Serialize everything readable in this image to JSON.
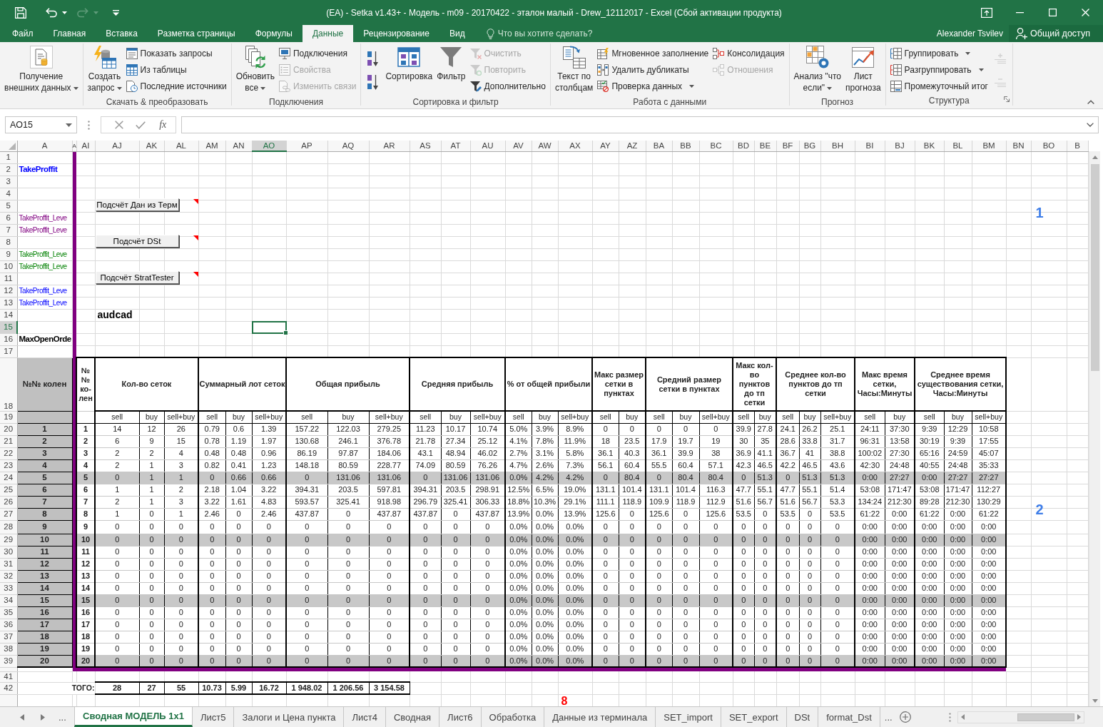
{
  "window": {
    "title": "(EA) - Setka v1.43+ - Модель - m09 - 20170422 - эталон малый - Drew_12112017 - Excel (Сбой активации продукта)"
  },
  "ribbon_tabs": [
    {
      "label": "Файл",
      "selected": false
    },
    {
      "label": "Главная",
      "selected": false
    },
    {
      "label": "Вставка",
      "selected": false
    },
    {
      "label": "Разметка страницы",
      "selected": false
    },
    {
      "label": "Формулы",
      "selected": false
    },
    {
      "label": "Данные",
      "selected": true
    },
    {
      "label": "Рецензирование",
      "selected": false
    },
    {
      "label": "Вид",
      "selected": false
    }
  ],
  "tell_me": {
    "placeholder": "Что вы хотите сделать?"
  },
  "account": {
    "user": "Alexander Tsvilev",
    "share": "Общий доступ"
  },
  "ribbon_groups": [
    {
      "commands": [
        {
          "kind": "large",
          "label": "Получение\nвнешних данных",
          "dropdown": true,
          "disabled": false
        }
      ]
    },
    {
      "label": "Скачать & преобразовать",
      "commands": [
        {
          "kind": "large",
          "label": "Создать\nзапрос",
          "dropdown": true,
          "disabled": false
        },
        {
          "kind": "small",
          "label": "Показать запросы",
          "dropdown": false,
          "disabled": false
        },
        {
          "kind": "small",
          "label": "Из таблицы",
          "dropdown": false,
          "disabled": false
        },
        {
          "kind": "small",
          "label": "Последние источники",
          "dropdown": false,
          "disabled": false
        }
      ]
    },
    {
      "label": "Подключения",
      "commands": [
        {
          "kind": "large",
          "label": "Обновить\nвсе",
          "dropdown": true,
          "disabled": false
        },
        {
          "kind": "small",
          "label": "Подключения",
          "dropdown": false,
          "disabled": false
        },
        {
          "kind": "small",
          "label": "Свойства",
          "dropdown": false,
          "disabled": true
        },
        {
          "kind": "small",
          "label": "Изменить связи",
          "dropdown": false,
          "disabled": true
        }
      ]
    },
    {
      "label": "Сортировка и фильтр",
      "commands": [
        {
          "kind": "icon",
          "disabled": false
        },
        {
          "kind": "icon",
          "disabled": false
        },
        {
          "kind": "large",
          "label": "Сортировка",
          "dropdown": false,
          "disabled": false
        },
        {
          "kind": "large",
          "label": "Фильтр",
          "dropdown": false,
          "disabled": false
        },
        {
          "kind": "small",
          "label": "Очистить",
          "dropdown": false,
          "disabled": true
        },
        {
          "kind": "small",
          "label": "Повторить",
          "dropdown": false,
          "disabled": true
        },
        {
          "kind": "small",
          "label": "Дополнительно",
          "dropdown": false,
          "disabled": false
        }
      ]
    },
    {
      "label": "Работа с данными",
      "commands": [
        {
          "kind": "large",
          "label": "Текст по\nстолбцам",
          "dropdown": false,
          "disabled": false
        },
        {
          "kind": "small",
          "label": "Мгновенное заполнение",
          "dropdown": false,
          "disabled": false
        },
        {
          "kind": "small",
          "label": "Удалить дубликаты",
          "dropdown": false,
          "disabled": false
        },
        {
          "kind": "small",
          "label": "Проверка данных",
          "dropdown": true,
          "disabled": false
        },
        {
          "kind": "small",
          "label": "Консолидация",
          "dropdown": false,
          "disabled": false
        },
        {
          "kind": "small",
          "label": "Отношения",
          "dropdown": false,
          "disabled": true
        }
      ]
    },
    {
      "label": "Прогноз",
      "commands": [
        {
          "kind": "large",
          "label": "Анализ \"что\nесли\"",
          "dropdown": true,
          "disabled": false
        },
        {
          "kind": "large",
          "label": "Лист\nпрогноза",
          "dropdown": false,
          "disabled": false
        }
      ]
    },
    {
      "label": "Структура",
      "launcher": true,
      "commands": [
        {
          "kind": "small",
          "label": "Группировать",
          "dropdown": true,
          "disabled": false
        },
        {
          "kind": "small",
          "label": "Разгруппировать",
          "dropdown": true,
          "disabled": false
        },
        {
          "kind": "small",
          "label": "Промежуточный итог",
          "dropdown": false,
          "disabled": false
        },
        {
          "kind": "icon",
          "disabled": true
        },
        {
          "kind": "icon",
          "disabled": true
        }
      ]
    }
  ],
  "formula_bar": {
    "name_box": "AO15",
    "function_label": "fx"
  },
  "columns": [
    {
      "label": "A",
      "selected": false
    },
    {
      "label": "A",
      "selected": false
    },
    {
      "label": "AI",
      "selected": false
    },
    {
      "label": "AJ",
      "selected": false
    },
    {
      "label": "AK",
      "selected": false
    },
    {
      "label": "AL",
      "selected": false
    },
    {
      "label": "AM",
      "selected": false
    },
    {
      "label": "AN",
      "selected": false
    },
    {
      "label": "AO",
      "selected": true
    },
    {
      "label": "AP",
      "selected": false
    },
    {
      "label": "AQ",
      "selected": false
    },
    {
      "label": "AR",
      "selected": false
    },
    {
      "label": "AS",
      "selected": false
    },
    {
      "label": "AT",
      "selected": false
    },
    {
      "label": "AU",
      "selected": false
    },
    {
      "label": "AV",
      "selected": false
    },
    {
      "label": "AW",
      "selected": false
    },
    {
      "label": "AX",
      "selected": false
    },
    {
      "label": "AY",
      "selected": false
    },
    {
      "label": "AZ",
      "selected": false
    },
    {
      "label": "BA",
      "selected": false
    },
    {
      "label": "BB",
      "selected": false
    },
    {
      "label": "BC",
      "selected": false
    },
    {
      "label": "BD",
      "selected": false
    },
    {
      "label": "BE",
      "selected": false
    },
    {
      "label": "BF",
      "selected": false
    },
    {
      "label": "BG",
      "selected": false
    },
    {
      "label": "BH",
      "selected": false
    },
    {
      "label": "BI",
      "selected": false
    },
    {
      "label": "BJ",
      "selected": false
    },
    {
      "label": "BK",
      "selected": false
    },
    {
      "label": "BL",
      "selected": false
    },
    {
      "label": "BM",
      "selected": false
    },
    {
      "label": "BN",
      "selected": false
    },
    {
      "label": "BO",
      "selected": false
    },
    {
      "label": "B",
      "selected": false
    }
  ],
  "rows": [
    {
      "row": "1",
      "selected": false
    },
    {
      "row": "2",
      "selected": false,
      "cell_a": {
        "text": "TakeProffit",
        "color": "#0000ff",
        "bold": true
      }
    },
    {
      "row": "3",
      "selected": false
    },
    {
      "row": "4",
      "selected": false
    },
    {
      "row": "5",
      "selected": false,
      "button": {
        "label": "Подсчёт Дан из Терм",
        "comment": true
      },
      "cell_bo": {
        "text": "1"
      }
    },
    {
      "row": "6",
      "selected": false,
      "cell_a": {
        "text": "TakeProffit_Leve",
        "color": "#800080",
        "bold": false
      }
    },
    {
      "row": "7",
      "selected": false,
      "cell_a": {
        "text": "TakeProffit_Leve",
        "color": "#800080",
        "bold": false
      }
    },
    {
      "row": "8",
      "selected": false,
      "button": {
        "label": "Подсчёт DSt",
        "comment": true
      }
    },
    {
      "row": "9",
      "selected": false,
      "cell_a": {
        "text": "TakeProffit_Leve",
        "color": "#008000",
        "bold": false
      }
    },
    {
      "row": "10",
      "selected": false,
      "cell_a": {
        "text": "TakeProffit_Leve",
        "color": "#008000",
        "bold": false
      }
    },
    {
      "row": "11",
      "selected": false,
      "button": {
        "label": "Подсчёт StratTester",
        "comment": true
      }
    },
    {
      "row": "12",
      "selected": false,
      "cell_a": {
        "text": "TakeProffit_Leve",
        "color": "#0000ff",
        "bold": false
      }
    },
    {
      "row": "13",
      "selected": false,
      "cell_a": {
        "text": "TakeProffit_Leve",
        "color": "#0000ff",
        "bold": false
      }
    },
    {
      "row": "14",
      "selected": false,
      "cell_aj": {
        "text": "audcad"
      }
    },
    {
      "row": "15",
      "selected": true
    },
    {
      "row": "16",
      "selected": false,
      "cell_a": {
        "text": "MaxOpenOrde",
        "color": "#000000",
        "bold": true
      }
    },
    {
      "row": "17",
      "selected": false
    }
  ],
  "table": {
    "heading_rows": [
      {
        "row": "18",
        "selected": false
      },
      {
        "row": "19",
        "selected": false
      }
    ],
    "corner_heading": "№№ колен",
    "index_heading": "№ № ко-лен",
    "groups": [
      {
        "label": "Кол-во сеток",
        "columns": [
          "sell",
          "buy",
          "sell+buy"
        ]
      },
      {
        "label": "Суммарный лот сеток",
        "columns": [
          "sell",
          "buy",
          "sell+buy"
        ]
      },
      {
        "label": "Общая прибыль",
        "columns": [
          "sell",
          "buy",
          "sell+buy"
        ]
      },
      {
        "label": "Средняя прибыль",
        "columns": [
          "sell",
          "buy",
          "sell+buy"
        ]
      },
      {
        "label": "% от общей прибыли",
        "columns": [
          "sell",
          "buy",
          "sell+buy"
        ]
      },
      {
        "label": "Макс размер сетки в пунктах",
        "columns": [
          "sell",
          "buy"
        ]
      },
      {
        "label": "Средний размер сетки в пунктах",
        "columns": [
          "sell",
          "buy",
          "sell+buy"
        ]
      },
      {
        "label": "Макс кол-во пунктов до тп сетки",
        "columns": [
          "sell",
          "buy"
        ]
      },
      {
        "label": "Среднее кол-во пунктов до тп сетки",
        "columns": [
          "sell",
          "buy",
          "sell+buy"
        ]
      },
      {
        "label": "Макс время сетки, Часы:Минуты",
        "columns": [
          "sell",
          "buy"
        ]
      },
      {
        "label": "Среднее время существования сетки, Часы:Минуты",
        "columns": [
          "sell",
          "buy",
          "sell+buy"
        ]
      }
    ],
    "rows": [
      {
        "row": "20",
        "selected": false,
        "shaded": false,
        "number": "1",
        "index": "1",
        "values": [
          "14",
          "12",
          "26",
          "0.79",
          "0.6",
          "1.39",
          "157.22",
          "122.03",
          "279.25",
          "11.23",
          "10.17",
          "10.74",
          "5.0%",
          "3.9%",
          "8.9%",
          "0",
          "0",
          "0",
          "0",
          "0",
          "39.9",
          "27.8",
          "24.1",
          "26.2",
          "25.1",
          "24:11",
          "37:30",
          "9:39",
          "12:29",
          "10:58"
        ]
      },
      {
        "row": "21",
        "selected": false,
        "shaded": false,
        "number": "2",
        "index": "2",
        "values": [
          "6",
          "9",
          "15",
          "0.78",
          "1.19",
          "1.97",
          "130.68",
          "246.1",
          "376.78",
          "21.78",
          "27.34",
          "25.12",
          "4.1%",
          "7.8%",
          "11.9%",
          "18",
          "23.5",
          "17.9",
          "19.7",
          "19",
          "30",
          "35",
          "28.6",
          "33.8",
          "31.7",
          "96:31",
          "13:58",
          "30:19",
          "9:39",
          "17:55"
        ]
      },
      {
        "row": "22",
        "selected": false,
        "shaded": false,
        "number": "3",
        "index": "3",
        "values": [
          "2",
          "2",
          "4",
          "0.48",
          "0.48",
          "0.96",
          "86.19",
          "97.87",
          "184.06",
          "43.1",
          "48.94",
          "46.02",
          "2.7%",
          "3.1%",
          "5.8%",
          "36.1",
          "40.3",
          "36.1",
          "39.9",
          "38",
          "36.9",
          "41.1",
          "36.7",
          "41",
          "38.8",
          "100:02",
          "27:30",
          "65:16",
          "24:59",
          "45:07"
        ]
      },
      {
        "row": "23",
        "selected": false,
        "shaded": false,
        "number": "4",
        "index": "4",
        "values": [
          "2",
          "1",
          "3",
          "0.82",
          "0.41",
          "1.23",
          "148.18",
          "80.59",
          "228.77",
          "74.09",
          "80.59",
          "76.26",
          "4.7%",
          "2.6%",
          "7.3%",
          "56.1",
          "60.4",
          "55.5",
          "60.4",
          "57.1",
          "42.3",
          "46.5",
          "42.2",
          "46.5",
          "43.6",
          "42:30",
          "24:48",
          "40:55",
          "24:48",
          "35:33"
        ]
      },
      {
        "row": "24",
        "selected": false,
        "shaded": true,
        "number": "5",
        "index": "5",
        "values": [
          "0",
          "1",
          "1",
          "0",
          "0.66",
          "0.66",
          "0",
          "131.06",
          "131.06",
          "0",
          "131.06",
          "131.06",
          "0.0%",
          "4.2%",
          "4.2%",
          "0",
          "80.4",
          "0",
          "80.4",
          "80.4",
          "0",
          "51.3",
          "0",
          "51.3",
          "51.3",
          "0:00",
          "27:27",
          "0:00",
          "27:27",
          "27:27"
        ]
      },
      {
        "row": "25",
        "selected": false,
        "shaded": false,
        "number": "6",
        "index": "6",
        "values": [
          "1",
          "1",
          "2",
          "2.18",
          "1.04",
          "3.22",
          "394.31",
          "203.5",
          "597.81",
          "394.31",
          "203.5",
          "298.91",
          "12.5%",
          "6.5%",
          "19.0%",
          "131.1",
          "101.4",
          "131.1",
          "101.4",
          "116.3",
          "47.7",
          "55.1",
          "47.7",
          "55.1",
          "51.4",
          "53:08",
          "171:47",
          "53:08",
          "171:47",
          "112:27"
        ]
      },
      {
        "row": "26",
        "selected": false,
        "shaded": false,
        "number": "7",
        "index": "7",
        "values": [
          "2",
          "1",
          "3",
          "3.22",
          "1.61",
          "4.83",
          "593.57",
          "325.41",
          "918.98",
          "296.79",
          "325.41",
          "306.33",
          "18.8%",
          "10.3%",
          "29.1%",
          "111.1",
          "118.9",
          "109.9",
          "118.9",
          "112.9",
          "51.6",
          "56.7",
          "51.6",
          "56.7",
          "53.3",
          "134:24",
          "212:30",
          "89:28",
          "212:30",
          "130:29"
        ],
        "cell_bo": {
          "text": "2"
        }
      },
      {
        "row": "27",
        "selected": false,
        "shaded": false,
        "number": "8",
        "index": "8",
        "values": [
          "1",
          "0",
          "1",
          "2.46",
          "0",
          "2.46",
          "437.87",
          "0",
          "437.87",
          "437.87",
          "0",
          "437.87",
          "13.9%",
          "0.0%",
          "13.9%",
          "125.6",
          "0",
          "125.6",
          "0",
          "125.6",
          "53.5",
          "0",
          "53.5",
          "0",
          "53.5",
          "61:22",
          "0:00",
          "61:22",
          "0:00",
          "61:22"
        ]
      },
      {
        "row": "28",
        "selected": false,
        "shaded": false,
        "number": "9",
        "index": "9",
        "values": [
          "0",
          "0",
          "0",
          "0",
          "0",
          "0",
          "0",
          "0",
          "0",
          "0",
          "0",
          "0",
          "0.0%",
          "0.0%",
          "0.0%",
          "0",
          "0",
          "0",
          "0",
          "0",
          "0",
          "0",
          "0",
          "0",
          "0",
          "0:00",
          "0:00",
          "0:00",
          "0:00",
          "0:00"
        ]
      },
      {
        "row": "29",
        "selected": false,
        "shaded": true,
        "number": "10",
        "index": "10",
        "values": [
          "0",
          "0",
          "0",
          "0",
          "0",
          "0",
          "0",
          "0",
          "0",
          "0",
          "0",
          "0",
          "0.0%",
          "0.0%",
          "0.0%",
          "0",
          "0",
          "0",
          "0",
          "0",
          "0",
          "0",
          "0",
          "0",
          "0",
          "0:00",
          "0:00",
          "0:00",
          "0:00",
          "0:00"
        ]
      },
      {
        "row": "30",
        "selected": false,
        "shaded": false,
        "number": "11",
        "index": "11",
        "values": [
          "0",
          "0",
          "0",
          "0",
          "0",
          "0",
          "0",
          "0",
          "0",
          "0",
          "0",
          "0",
          "0.0%",
          "0.0%",
          "0.0%",
          "0",
          "0",
          "0",
          "0",
          "0",
          "0",
          "0",
          "0",
          "0",
          "0",
          "0:00",
          "0:00",
          "0:00",
          "0:00",
          "0:00"
        ]
      },
      {
        "row": "31",
        "selected": false,
        "shaded": false,
        "number": "12",
        "index": "12",
        "values": [
          "0",
          "0",
          "0",
          "0",
          "0",
          "0",
          "0",
          "0",
          "0",
          "0",
          "0",
          "0",
          "0.0%",
          "0.0%",
          "0.0%",
          "0",
          "0",
          "0",
          "0",
          "0",
          "0",
          "0",
          "0",
          "0",
          "0",
          "0:00",
          "0:00",
          "0:00",
          "0:00",
          "0:00"
        ]
      },
      {
        "row": "32",
        "selected": false,
        "shaded": false,
        "number": "13",
        "index": "13",
        "values": [
          "0",
          "0",
          "0",
          "0",
          "0",
          "0",
          "0",
          "0",
          "0",
          "0",
          "0",
          "0",
          "0.0%",
          "0.0%",
          "0.0%",
          "0",
          "0",
          "0",
          "0",
          "0",
          "0",
          "0",
          "0",
          "0",
          "0",
          "0:00",
          "0:00",
          "0:00",
          "0:00",
          "0:00"
        ]
      },
      {
        "row": "33",
        "selected": false,
        "shaded": false,
        "number": "14",
        "index": "14",
        "values": [
          "0",
          "0",
          "0",
          "0",
          "0",
          "0",
          "0",
          "0",
          "0",
          "0",
          "0",
          "0",
          "0.0%",
          "0.0%",
          "0.0%",
          "0",
          "0",
          "0",
          "0",
          "0",
          "0",
          "0",
          "0",
          "0",
          "0",
          "0:00",
          "0:00",
          "0:00",
          "0:00",
          "0:00"
        ]
      },
      {
        "row": "34",
        "selected": false,
        "shaded": true,
        "number": "15",
        "index": "15",
        "values": [
          "0",
          "0",
          "0",
          "0",
          "0",
          "0",
          "0",
          "0",
          "0",
          "0",
          "0",
          "0",
          "0.0%",
          "0.0%",
          "0.0%",
          "0",
          "0",
          "0",
          "0",
          "0",
          "0",
          "0",
          "0",
          "0",
          "0",
          "0:00",
          "0:00",
          "0:00",
          "0:00",
          "0:00"
        ]
      },
      {
        "row": "35",
        "selected": false,
        "shaded": false,
        "number": "16",
        "index": "16",
        "values": [
          "0",
          "0",
          "0",
          "0",
          "0",
          "0",
          "0",
          "0",
          "0",
          "0",
          "0",
          "0",
          "0.0%",
          "0.0%",
          "0.0%",
          "0",
          "0",
          "0",
          "0",
          "0",
          "0",
          "0",
          "0",
          "0",
          "0",
          "0:00",
          "0:00",
          "0:00",
          "0:00",
          "0:00"
        ]
      },
      {
        "row": "36",
        "selected": false,
        "shaded": false,
        "number": "17",
        "index": "17",
        "values": [
          "0",
          "0",
          "0",
          "0",
          "0",
          "0",
          "0",
          "0",
          "0",
          "0",
          "0",
          "0",
          "0.0%",
          "0.0%",
          "0.0%",
          "0",
          "0",
          "0",
          "0",
          "0",
          "0",
          "0",
          "0",
          "0",
          "0",
          "0:00",
          "0:00",
          "0:00",
          "0:00",
          "0:00"
        ]
      },
      {
        "row": "37",
        "selected": false,
        "shaded": false,
        "number": "18",
        "index": "18",
        "values": [
          "0",
          "0",
          "0",
          "0",
          "0",
          "0",
          "0",
          "0",
          "0",
          "0",
          "0",
          "0",
          "0.0%",
          "0.0%",
          "0.0%",
          "0",
          "0",
          "0",
          "0",
          "0",
          "0",
          "0",
          "0",
          "0",
          "0",
          "0:00",
          "0:00",
          "0:00",
          "0:00",
          "0:00"
        ]
      },
      {
        "row": "38",
        "selected": false,
        "shaded": false,
        "number": "19",
        "index": "19",
        "values": [
          "0",
          "0",
          "0",
          "0",
          "0",
          "0",
          "0",
          "0",
          "0",
          "0",
          "0",
          "0",
          "0.0%",
          "0.0%",
          "0.0%",
          "0",
          "0",
          "0",
          "0",
          "0",
          "0",
          "0",
          "0",
          "0",
          "0",
          "0:00",
          "0:00",
          "0:00",
          "0:00",
          "0:00"
        ]
      },
      {
        "row": "39",
        "selected": false,
        "shaded": true,
        "number": "20",
        "index": "20",
        "values": [
          "0",
          "0",
          "0",
          "0",
          "0",
          "0",
          "0",
          "0",
          "0",
          "0",
          "0",
          "0",
          "0.0%",
          "0.0%",
          "0.0%",
          "0",
          "0",
          "0",
          "0",
          "0",
          "0",
          "0",
          "0",
          "0",
          "0",
          "0:00",
          "0:00",
          "0:00",
          "0:00",
          "0:00"
        ]
      }
    ]
  },
  "footer_rows": [
    {
      "row": "41",
      "selected": false
    },
    {
      "row": "42",
      "selected": false,
      "totals_label": "ТОГО:",
      "totals": [
        "28",
        "27",
        "55",
        "10.73",
        "5.99",
        "16.72",
        "1 948.02",
        "1 206.56",
        "3 154.58"
      ]
    },
    {
      "selected": false,
      "cell_ax": {
        "text": "8"
      }
    }
  ],
  "sheet_tabs": {
    "more_left": "...",
    "tabs": [
      {
        "label": "Сводная МОДЕЛЬ 1x1",
        "selected": true
      },
      {
        "label": "Лист5",
        "selected": false
      },
      {
        "label": "Залоги и Цена пункта",
        "selected": false
      },
      {
        "label": "Лист4",
        "selected": false
      },
      {
        "label": "Сводная",
        "selected": false
      },
      {
        "label": "Лист6",
        "selected": false
      },
      {
        "label": "Обработка",
        "selected": false
      },
      {
        "label": "Данные из терминала",
        "selected": false
      },
      {
        "label": "SET_import",
        "selected": false
      },
      {
        "label": "SET_export",
        "selected": false
      },
      {
        "label": "DSt",
        "selected": false
      },
      {
        "label": "format_Dst",
        "selected": false
      }
    ],
    "more_right": "..."
  }
}
